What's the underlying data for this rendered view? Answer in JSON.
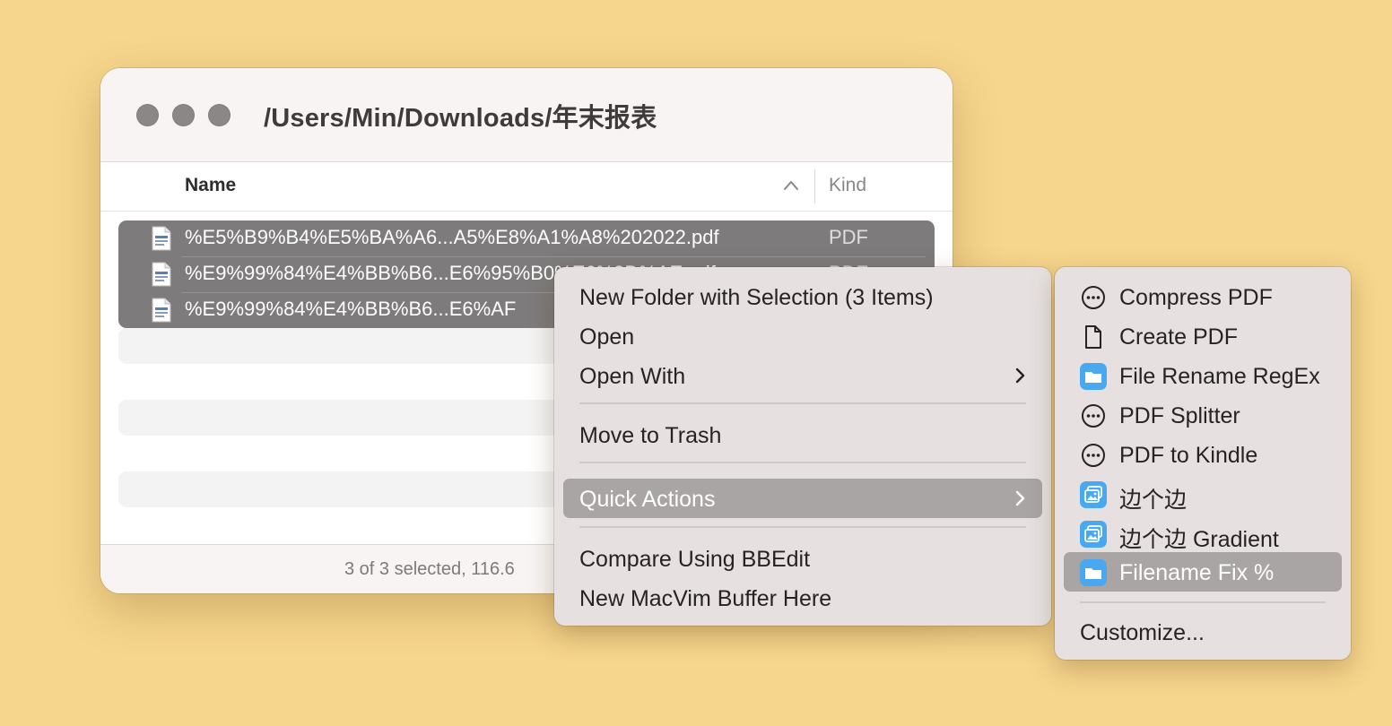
{
  "window": {
    "title": "/Users/Min/Downloads/年末报表",
    "columns": {
      "name": "Name",
      "kind": "Kind"
    },
    "files": [
      {
        "name": "%E5%B9%B4%E5%BA%A6...A5%E8%A1%A8%202022.pdf",
        "kind": "PDF"
      },
      {
        "name": "%E9%99%84%E4%BB%B6...E6%95%B0%E6%8D%AE.pdf",
        "kind": "PDF"
      },
      {
        "name": "%E9%99%84%E4%BB%B6...E6%AF",
        "kind": ""
      }
    ],
    "status": "3 of 3 selected, 116.6"
  },
  "context_menu": {
    "new_folder": "New Folder with Selection (3 Items)",
    "open": "Open",
    "open_with": "Open With",
    "move_to_trash": "Move to Trash",
    "quick_actions": "Quick Actions",
    "compare_bbedit": "Compare Using BBEdit",
    "new_macvim": "New MacVim Buffer Here"
  },
  "quick_actions_menu": {
    "items": [
      {
        "label": "Compress PDF",
        "icon": "ellipsis-circle-icon"
      },
      {
        "label": "Create PDF",
        "icon": "document-icon"
      },
      {
        "label": "File Rename RegEx",
        "icon": "folder-icon"
      },
      {
        "label": "PDF Splitter",
        "icon": "ellipsis-circle-icon"
      },
      {
        "label": "PDF to Kindle",
        "icon": "ellipsis-circle-icon"
      },
      {
        "label": "边个边",
        "icon": "photos-icon"
      },
      {
        "label": "边个边 Gradient",
        "icon": "photos-icon"
      },
      {
        "label": "Filename Fix %",
        "icon": "folder-icon"
      }
    ],
    "customize": "Customize..."
  },
  "colors": {
    "desktop": "#f6d58c",
    "selection": "#7d7b7b",
    "menu_bg": "#e6e1e0",
    "menu_highlight": "#a9a5a4",
    "action_blue": "#4aa8f0"
  }
}
